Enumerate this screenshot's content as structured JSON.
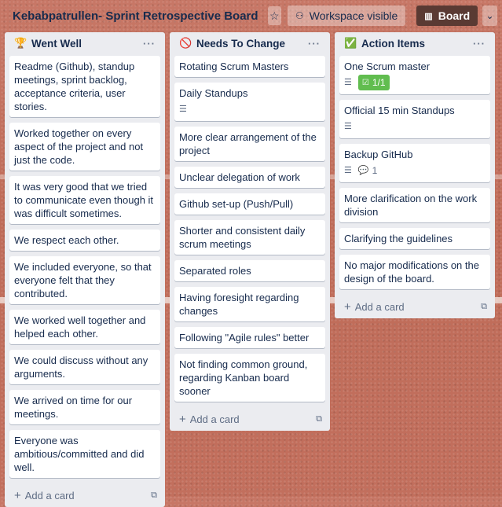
{
  "header": {
    "board_title": "Kebabpatrullen- Sprint Retrospective Board",
    "star_icon": "star-icon",
    "visibility_label": "Workspace visible",
    "view_label": "Board"
  },
  "lists": [
    {
      "emoji": "🏆",
      "title": "Went Well",
      "cards": [
        {
          "text": "Readme (Github), standup meetings, sprint backlog, acceptance criteria, user stories."
        },
        {
          "text": "Worked together on every aspect of the project and not just the code."
        },
        {
          "text": "It was very good that we tried to communicate even though it was difficult sometimes."
        },
        {
          "text": "We respect each other."
        },
        {
          "text": "We included everyone, so that everyone felt that they contributed."
        },
        {
          "text": "We worked well together and helped each other."
        },
        {
          "text": "We could discuss without any arguments."
        },
        {
          "text": "We arrived on time for our meetings."
        },
        {
          "text": "Everyone was ambitious/committed and did well."
        }
      ],
      "add_label": "Add a card"
    },
    {
      "emoji": "🚫",
      "title": "Needs To Change",
      "cards": [
        {
          "text": "Rotating Scrum Masters"
        },
        {
          "text": "Daily Standups",
          "description": true
        },
        {
          "text": "More clear arrangement of the project"
        },
        {
          "text": "Unclear delegation of work"
        },
        {
          "text": "Github set-up (Push/Pull)"
        },
        {
          "text": "Shorter and consistent daily scrum meetings"
        },
        {
          "text": "Separated roles"
        },
        {
          "text": "Having foresight regarding changes"
        },
        {
          "text": "Following \"Agile rules\" better"
        },
        {
          "text": "Not finding common ground, regarding Kanban board sooner"
        }
      ],
      "add_label": "Add a card"
    },
    {
      "emoji": "✅",
      "title": "Action Items",
      "cards": [
        {
          "text": "One Scrum master",
          "description": true,
          "checklist": "1/1"
        },
        {
          "text": "Official 15 min Standups",
          "description": true
        },
        {
          "text": "Backup GitHub",
          "description": true,
          "comments": "1"
        },
        {
          "text": "More clarification on the work division"
        },
        {
          "text": "Clarifying the guidelines"
        },
        {
          "text": "No major modifications on the design of the board."
        }
      ],
      "add_label": "Add a card"
    }
  ],
  "colors": {
    "background": "#c36f5c",
    "list_bg": "#ebecf0",
    "board_button": "#5a3a33",
    "checklist_complete": "#61bd4f"
  }
}
